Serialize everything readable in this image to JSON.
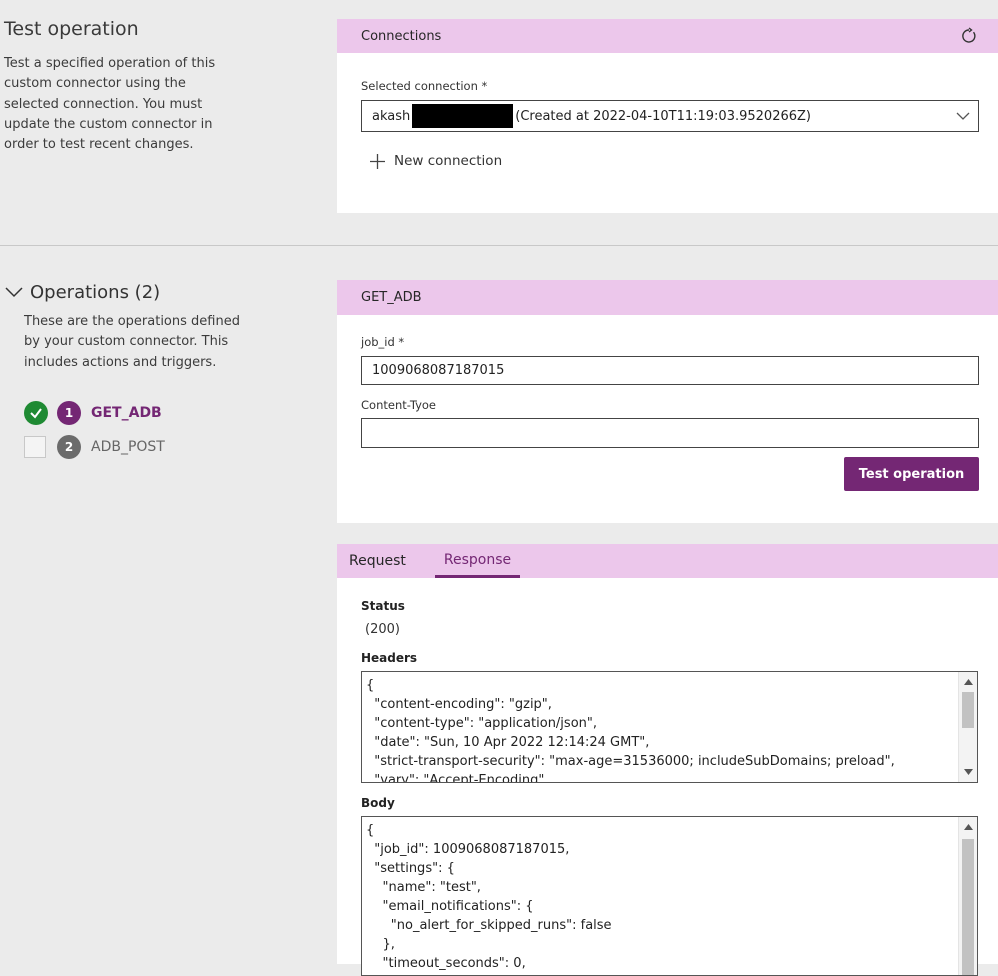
{
  "left": {
    "title": "Test operation",
    "description": "Test a specified operation of this custom connector using the selected connection. You must update the custom connector in order to test recent changes.",
    "operations_title": "Operations (2)",
    "operations_description": "These are the operations defined by your custom connector. This includes actions and triggers.",
    "operations": [
      {
        "number": "1",
        "label": "GET_ADB",
        "checked": true
      },
      {
        "number": "2",
        "label": "ADB_POST",
        "checked": false
      }
    ]
  },
  "connections": {
    "header": "Connections",
    "selected_label": "Selected connection *",
    "selected_prefix": "akash",
    "selected_suffix": "(Created at 2022-04-10T11:19:03.9520266Z)",
    "new_connection": "New connection"
  },
  "operation": {
    "header": "GET_ADB",
    "job_id_label": "job_id *",
    "job_id_value": "1009068087187015",
    "content_type_label": "Content-Tyoe",
    "content_type_value": "",
    "test_button": "Test operation"
  },
  "tabs": {
    "request": "Request",
    "response": "Response",
    "active": "Response"
  },
  "response": {
    "status_label": "Status",
    "status_value": "(200)",
    "headers_label": "Headers",
    "headers_text": "{\n  \"content-encoding\": \"gzip\",\n  \"content-type\": \"application/json\",\n  \"date\": \"Sun, 10 Apr 2022 12:14:24 GMT\",\n  \"strict-transport-security\": \"max-age=31536000; includeSubDomains; preload\",\n  \"vary\": \"Accept-Encoding\"",
    "body_label": "Body",
    "body_text": "{\n  \"job_id\": 1009068087187015,\n  \"settings\": {\n    \"name\": \"test\",\n    \"email_notifications\": {\n      \"no_alert_for_skipped_runs\": false\n    },\n    \"timeout_seconds\": 0,"
  },
  "colors": {
    "accent": "#742774",
    "header_bg": "#ecc7eb",
    "success": "#1f8a33",
    "inactive_badge": "#6b6b6b"
  }
}
